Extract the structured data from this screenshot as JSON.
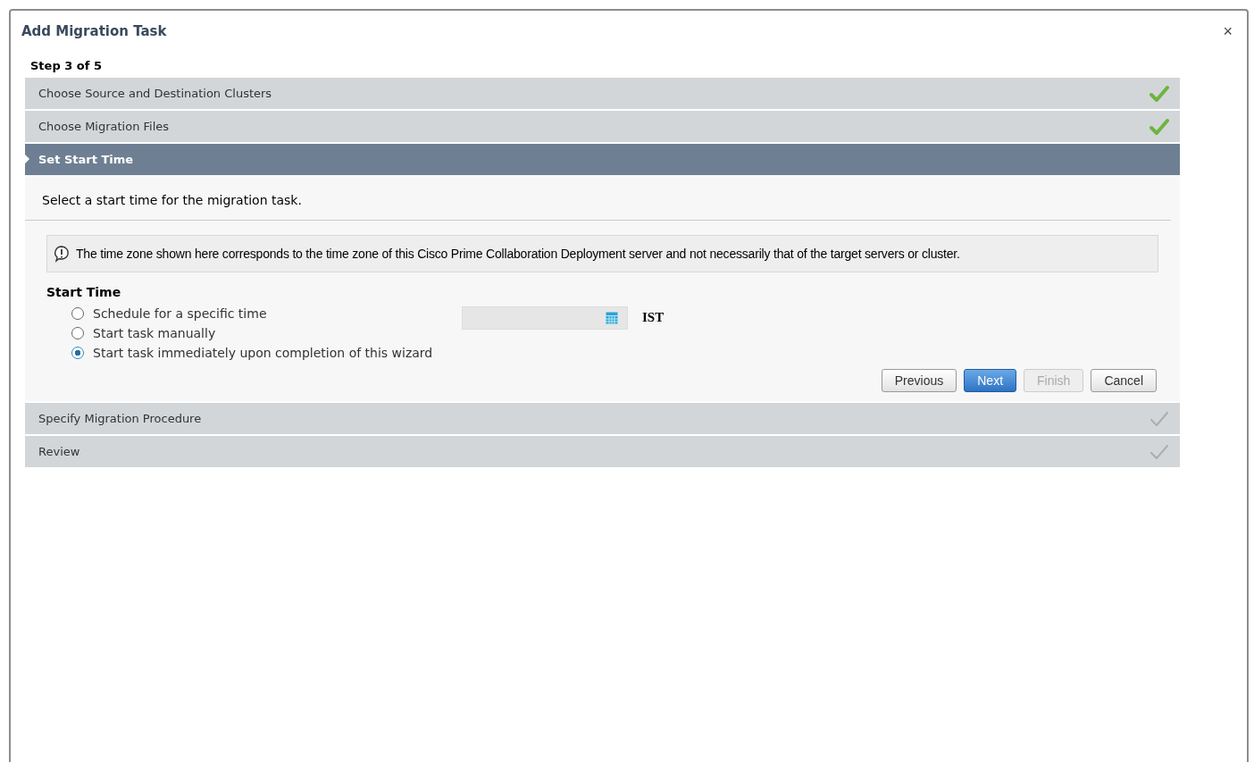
{
  "dialog": {
    "title": "Add Migration Task",
    "close": "×"
  },
  "step_indicator": "Step 3 of 5",
  "steps": [
    {
      "label": "Choose Source and Destination Clusters",
      "selected": false,
      "completed": true
    },
    {
      "label": "Choose Migration Files",
      "selected": false,
      "completed": true
    },
    {
      "label": "Set Start Time",
      "selected": true,
      "completed": false
    },
    {
      "label": "Specify Migration Procedure",
      "selected": false,
      "completed": false
    },
    {
      "label": "Review",
      "selected": false,
      "completed": false
    }
  ],
  "panel": {
    "instruction": "Select a start time for the migration task.",
    "info": "The time zone shown here corresponds to the time zone of this Cisco Prime Collaboration Deployment server and not necessarily that of the target servers or cluster.",
    "section_title": "Start Time",
    "options": [
      {
        "label": "Schedule for a specific time",
        "selected": false
      },
      {
        "label": "Start task manually",
        "selected": false
      },
      {
        "label": "Start task immediately upon completion of this wizard",
        "selected": true
      }
    ],
    "date_field": {
      "disabled": true
    },
    "timezone": "IST",
    "buttons": [
      {
        "label": "Previous",
        "kind": "default",
        "disabled": false
      },
      {
        "label": "Next",
        "kind": "primary",
        "disabled": false
      },
      {
        "label": "Finish",
        "kind": "default",
        "disabled": true
      },
      {
        "label": "Cancel",
        "kind": "default",
        "disabled": false
      }
    ]
  }
}
